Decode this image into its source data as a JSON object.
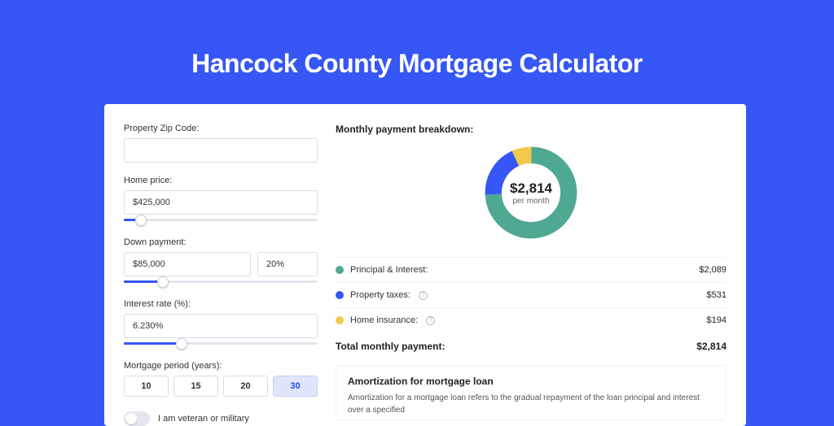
{
  "page_title": "Hancock County Mortgage Calculator",
  "form": {
    "zip": {
      "label": "Property Zip Code:",
      "value": ""
    },
    "home_price": {
      "label": "Home price:",
      "value": "$425,000",
      "slider_percent": 9
    },
    "down_payment": {
      "label": "Down payment:",
      "amount": "$85,000",
      "percent": "20%",
      "slider_percent": 20
    },
    "interest_rate": {
      "label": "Interest rate (%):",
      "value": "6.230%",
      "slider_percent": 30
    },
    "mortgage_period": {
      "label": "Mortgage period (years):",
      "options": [
        "10",
        "15",
        "20",
        "30"
      ],
      "selected": "30"
    },
    "veteran_toggle": {
      "label": "I am veteran or military",
      "on": false
    }
  },
  "breakdown": {
    "title": "Monthly payment breakdown:",
    "center_amount": "$2,814",
    "center_sub": "per month",
    "items": [
      {
        "label": "Principal & Interest:",
        "value": "$2,089",
        "color": "#4fa892",
        "info": false
      },
      {
        "label": "Property taxes:",
        "value": "$531",
        "color": "#3656f5",
        "info": true
      },
      {
        "label": "Home insurance:",
        "value": "$194",
        "color": "#f0c94d",
        "info": true
      }
    ],
    "total_label": "Total monthly payment:",
    "total_value": "$2,814"
  },
  "chart_data": {
    "type": "pie",
    "title": "Monthly payment breakdown",
    "categories": [
      "Principal & Interest",
      "Property taxes",
      "Home insurance"
    ],
    "values": [
      2089,
      531,
      194
    ],
    "colors": [
      "#4fa892",
      "#3656f5",
      "#f0c94d"
    ],
    "center_label": "$2,814 per month"
  },
  "amortization": {
    "title": "Amortization for mortgage loan",
    "text": "Amortization for a mortgage loan refers to the gradual repayment of the loan principal and interest over a specified"
  }
}
